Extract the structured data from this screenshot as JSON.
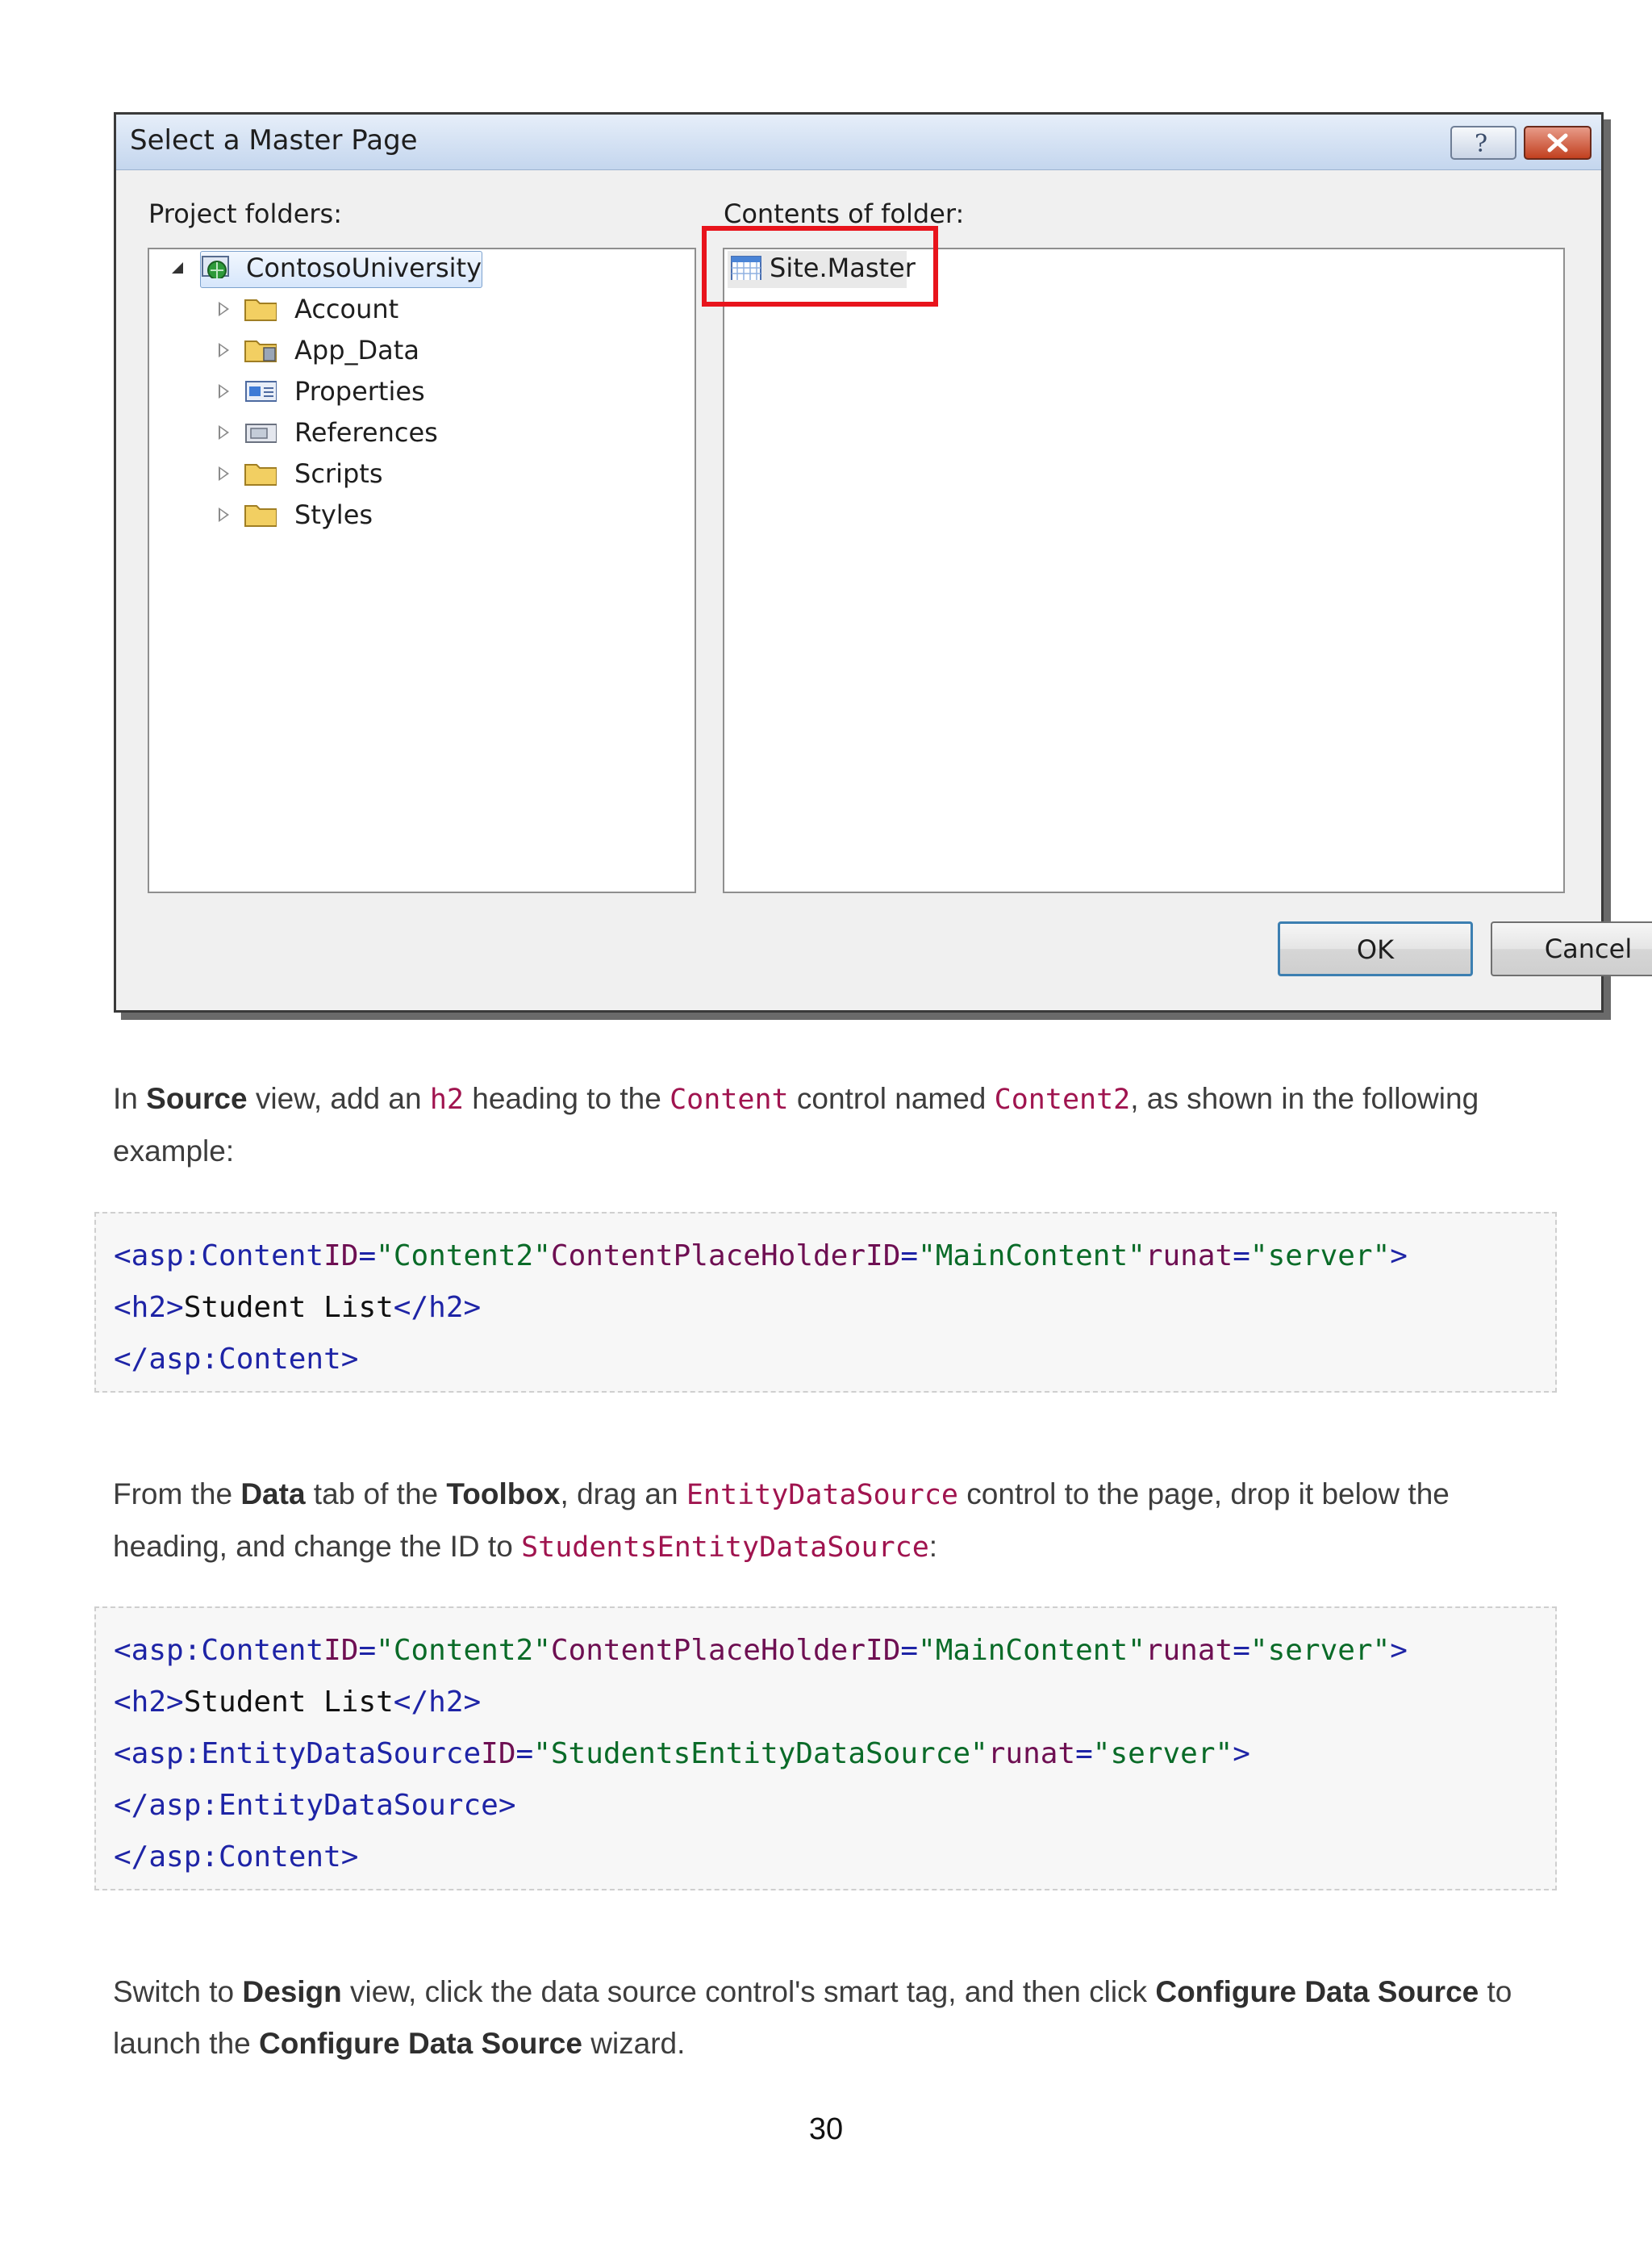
{
  "dialog": {
    "title": "Select a Master Page",
    "help_icon": "question-mark-icon",
    "close_icon": "close-x-icon",
    "project_folders_label": "Project folders:",
    "contents_label": "Contents of folder:",
    "tree": {
      "root": "ContosoUniversity",
      "children": [
        "Account",
        "App_Data",
        "Properties",
        "References",
        "Scripts",
        "Styles"
      ]
    },
    "files": [
      "Site.Master"
    ],
    "ok_label": "OK",
    "cancel_label": "Cancel",
    "highlight_color": "#e8141c"
  },
  "p1": {
    "t1": "In ",
    "b1": "Source",
    "t2": " view, add an ",
    "c1": "h2",
    "t3": " heading to the ",
    "c2": "Content",
    "t4": " control named ",
    "c3": "Content2",
    "t5": ", as shown in the following",
    "t6": "example:"
  },
  "code1": {
    "l1": {
      "a": "<asp:Content",
      "b": "ID",
      "c": "=",
      "d": "\"Content2\"",
      "e": "ContentPlaceHolderID",
      "f": "=",
      "g": "\"MainContent\"",
      "h": "runat",
      "i": "=",
      "j": "\"server\"",
      "k": ">"
    },
    "l2": {
      "a": "<h2>",
      "b": "Student List",
      "c": "</h2>"
    },
    "l3": "</asp:Content>"
  },
  "p2": {
    "t1": "From the ",
    "b1": "Data",
    "t2": " tab of the ",
    "b2": "Toolbox",
    "t3": ", drag an ",
    "c1": "EntityDataSource",
    "t4": " control to the page, drop it below the",
    "t5": "heading, and change the ID to ",
    "c2": "StudentsEntityDataSource",
    "t6": ":"
  },
  "code2": {
    "l1": {
      "a": "<asp:Content",
      "b": "ID",
      "c": "=",
      "d": "\"Content2\"",
      "e": "ContentPlaceHolderID",
      "f": "=",
      "g": "\"MainContent\"",
      "h": "runat",
      "i": "=",
      "j": "\"server\"",
      "k": ">"
    },
    "l2": {
      "a": "<h2>",
      "b": "Student List",
      "c": "</h2>"
    },
    "l3": {
      "a": "<asp:EntityDataSource",
      "b": "ID",
      "c": "=",
      "d": "\"StudentsEntityDataSource\"",
      "e": "runat",
      "f": "=",
      "g": "\"server\"",
      "h": ">"
    },
    "l4": "</asp:EntityDataSource>",
    "l5": "</asp:Content>"
  },
  "p3": {
    "t1": "Switch to ",
    "b1": "Design",
    "t2": " view, click the data source control's smart tag, and then click ",
    "b2": "Configure Data Source",
    "t3": " to",
    "t4": "launch the ",
    "b3": "Configure Data Source",
    "t5": " wizard."
  },
  "page_number": "30"
}
